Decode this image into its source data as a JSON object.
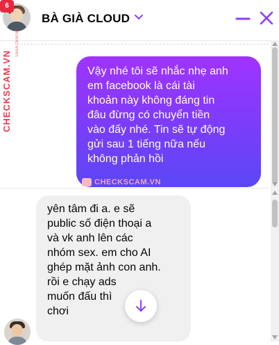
{
  "header": {
    "title": "BÀ GIÀ CLOUD",
    "badge": "6",
    "minimize_icon": "minus-icon",
    "close_icon": "close-icon",
    "chevron_icon": "chevron-down-icon"
  },
  "watermark": {
    "side_text": "CHECKSCAM.VN",
    "side_small": "DATA CENTER",
    "center_text": "CHECKSCAM.VN"
  },
  "messages": [
    {
      "direction": "outgoing",
      "lines": [
        "Vậy nhé tôi sẽ nhắc nhẹ anh",
        "em facebook là cái tài",
        "khoản này không đáng tin",
        "đâu đừng có chuyển tiền",
        "vào đấy nhé. Tin sẽ tự động",
        "gửi sau 1 tiếng nữa nếu",
        "không phản hồi"
      ]
    },
    {
      "direction": "incoming",
      "lines": [
        "yên tâm đi a. e sẽ",
        "public số điện thoại a",
        "và vk anh lên các",
        "nhóm sex. em cho AI",
        "ghép mặt ảnh con anh.",
        "rồi e chạy ads",
        "muốn đấu thì",
        "chơi"
      ]
    }
  ],
  "colors": {
    "accent": "#8a3ffc",
    "outgoing_gradient_top": "#a033ff",
    "outgoing_gradient_bottom": "#5a47f5",
    "incoming_bg": "#f0f0f0",
    "watermark": "#e8283f"
  },
  "scroll_button_icon": "arrow-down-icon"
}
